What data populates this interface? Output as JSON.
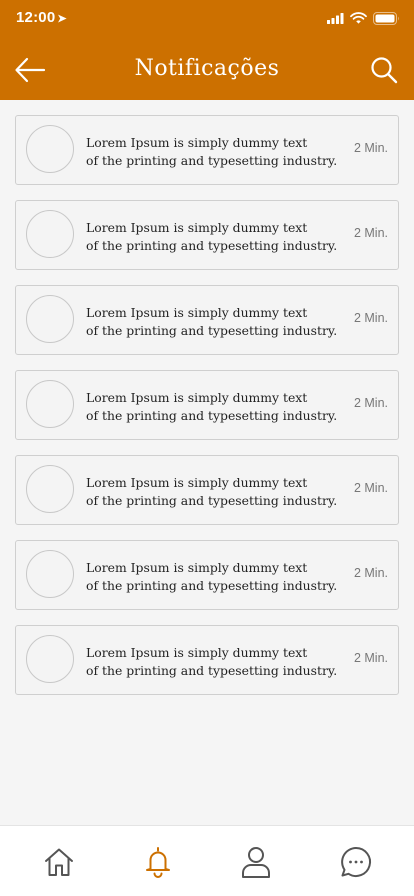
{
  "status": {
    "time": "12:00",
    "location_icon": "location-arrow-icon"
  },
  "header": {
    "title": "Notificações",
    "color": "#cc7000",
    "back_icon": "arrow-left-icon",
    "search_icon": "search-icon"
  },
  "notifications": [
    {
      "line1": "Lorem Ipsum is simply dummy text",
      "line2": "of the printing and typesetting industry.",
      "time": "2 Min."
    },
    {
      "line1": "Lorem Ipsum is simply dummy text",
      "line2": "of the printing and typesetting industry.",
      "time": "2 Min."
    },
    {
      "line1": "Lorem Ipsum is simply dummy text",
      "line2": "of the printing and typesetting industry.",
      "time": "2 Min."
    },
    {
      "line1": "Lorem Ipsum is simply dummy text",
      "line2": "of the printing and typesetting industry.",
      "time": "2 Min."
    },
    {
      "line1": "Lorem Ipsum is simply dummy text",
      "line2": "of the printing and typesetting industry.",
      "time": "2 Min."
    },
    {
      "line1": "Lorem Ipsum is simply dummy text",
      "line2": "of the printing and typesetting industry.",
      "time": "2 Min."
    },
    {
      "line1": "Lorem Ipsum is simply dummy text",
      "line2": "of the printing and typesetting industry.",
      "time": "2 Min."
    }
  ],
  "tabbar": {
    "active_color": "#cc7000",
    "inactive_color": "#555555",
    "items": [
      {
        "icon": "home-icon",
        "active": false
      },
      {
        "icon": "bell-icon",
        "active": true
      },
      {
        "icon": "user-icon",
        "active": false
      },
      {
        "icon": "chat-icon",
        "active": false
      }
    ]
  }
}
